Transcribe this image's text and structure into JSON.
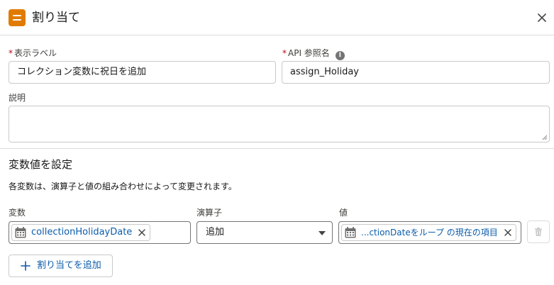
{
  "header": {
    "title": "割り当て"
  },
  "fields": {
    "label_label": "表示ラベル",
    "label_value": "コレクション変数に祝日を追加",
    "api_label": "API 参照名",
    "api_value": "assign_Holiday",
    "description_label": "説明",
    "description_value": ""
  },
  "required_marker": "*",
  "info_glyph": "i",
  "section": {
    "title": "変数値を設定",
    "description": "各変数は、演算子と値の組み合わせによって変更されます。"
  },
  "assignment": {
    "variable_label": "変数",
    "operator_label": "演算子",
    "value_label": "値",
    "variable_pill": "collectionHolidayDate",
    "operator_value": "追加",
    "value_pill": "...ctionDateをループ の現在の項目"
  },
  "add_button_label": "割り当てを追加",
  "icons": {
    "header": "assignment-icon",
    "close": "close-icon",
    "info": "info-icon",
    "calendar": "calendar-icon",
    "remove": "clear-icon",
    "delete": "trash-icon",
    "add": "plus-icon"
  },
  "colors": {
    "header_icon_bg": "#e07b00",
    "link": "#0b5cab",
    "required": "#ba0517"
  }
}
